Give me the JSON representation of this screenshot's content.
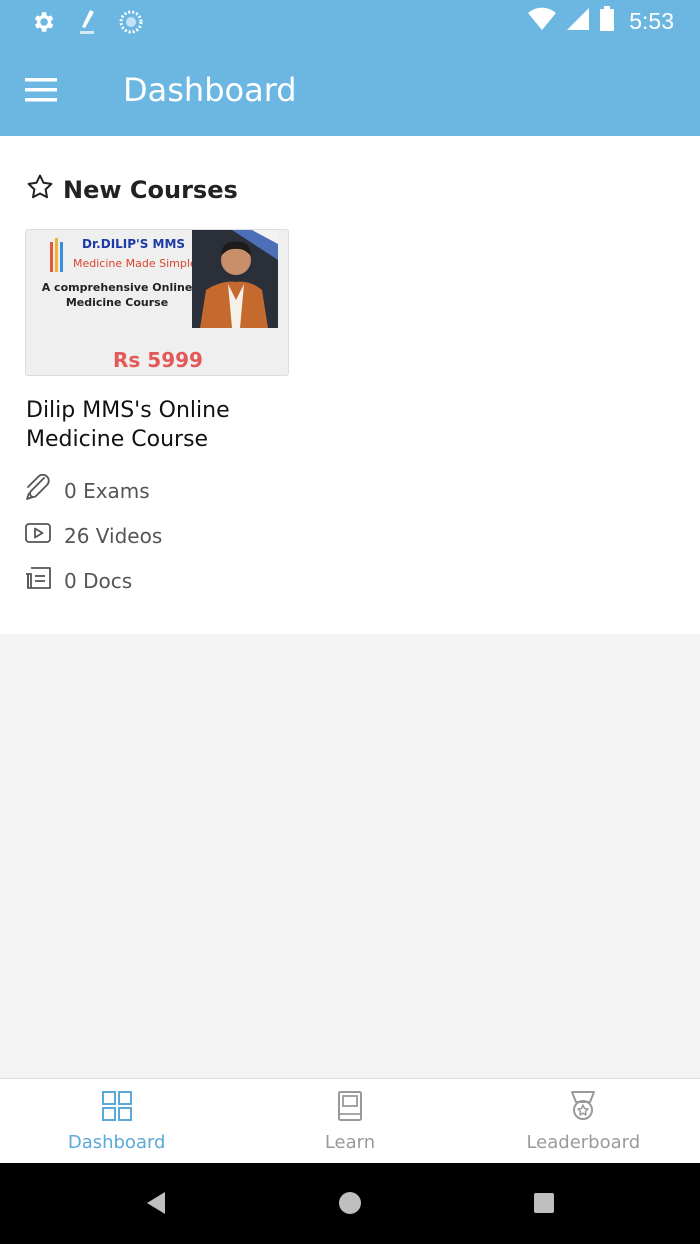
{
  "status_bar": {
    "time": "5:53",
    "icons": [
      "settings-icon",
      "pen-icon",
      "sync-icon",
      "wifi-icon",
      "signal-icon",
      "battery-icon"
    ]
  },
  "app_bar": {
    "title": "Dashboard",
    "menu_icon": "hamburger-menu-icon"
  },
  "section": {
    "title": "New Courses",
    "icon": "star-outline-icon"
  },
  "course": {
    "thumbnail": {
      "brand_line1": "Dr.DILIP'S MMS",
      "brand_line2": "Medicine Made Simple",
      "tagline": "A comprehensive Online Medicine Course",
      "price": "Rs 5999"
    },
    "title": "Dilip MMS's Online Medicine Course",
    "stats": {
      "exams": "0 Exams",
      "videos": "26 Videos",
      "docs": "0 Docs"
    }
  },
  "bottom_nav": {
    "items": [
      {
        "label": "Dashboard",
        "icon": "grid-icon",
        "active": true
      },
      {
        "label": "Learn",
        "icon": "book-icon",
        "active": false
      },
      {
        "label": "Leaderboard",
        "icon": "medal-icon",
        "active": false
      }
    ]
  },
  "colors": {
    "primary": "#6bb7e2",
    "active_nav": "#5aa9d9",
    "price": "#e45858",
    "inactive": "#9a9a9a"
  }
}
